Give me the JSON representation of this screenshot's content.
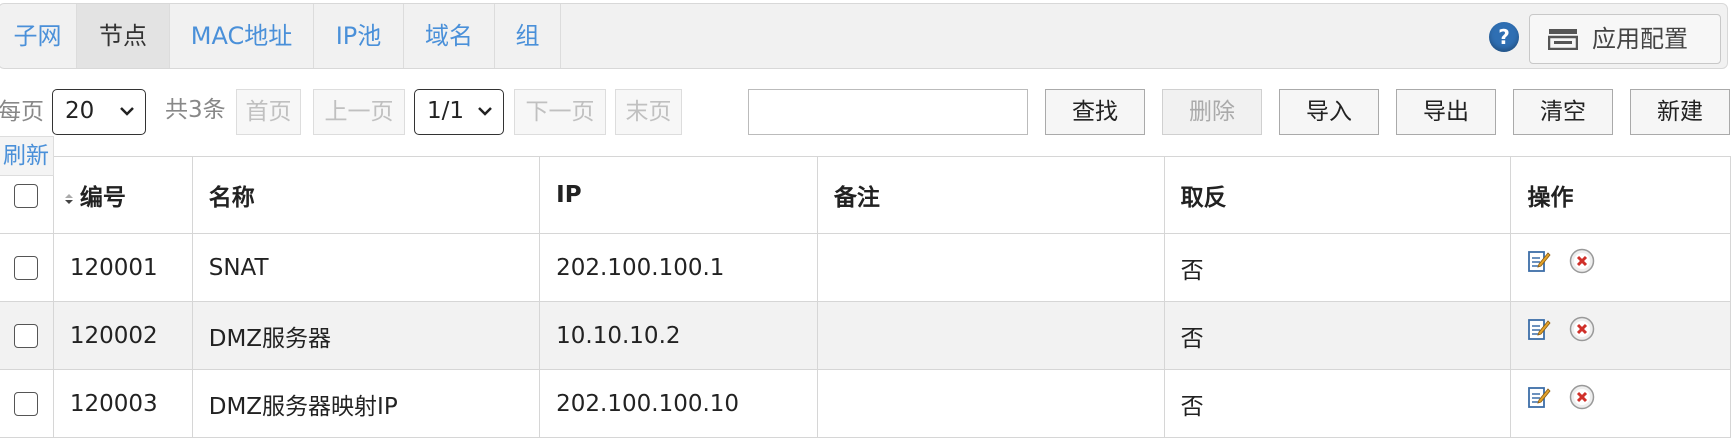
{
  "tabs": [
    {
      "label": "子网",
      "active": false
    },
    {
      "label": "节点",
      "active": true
    },
    {
      "label": "MAC地址",
      "active": false
    },
    {
      "label": "IP池",
      "active": false
    },
    {
      "label": "域名",
      "active": false
    },
    {
      "label": "组",
      "active": false
    }
  ],
  "header": {
    "help_icon": "question-mark",
    "help_glyph": "?",
    "apply_label": "应用配置",
    "apply_icon": "config-icon"
  },
  "pager": {
    "per_page_label": "每页",
    "per_page_value": "20",
    "total_label": "共3条",
    "first_label": "首页",
    "prev_label": "上一页",
    "page_value": "1/1",
    "next_label": "下一页",
    "last_label": "末页"
  },
  "search": {
    "value": "",
    "placeholder": ""
  },
  "actions": {
    "find": "查找",
    "delete": "删除",
    "import": "导入",
    "export": "导出",
    "clear": "清空",
    "new": "新建"
  },
  "refresh_label": "刷新",
  "table": {
    "columns": [
      "编号",
      "名称",
      "IP",
      "备注",
      "取反",
      "操作"
    ],
    "rows": [
      {
        "id": "120001",
        "name": "SNAT",
        "ip": "202.100.100.1",
        "note": "",
        "invert": "否"
      },
      {
        "id": "120002",
        "name": "DMZ服务器",
        "ip": "10.10.10.2",
        "note": "",
        "invert": "否"
      },
      {
        "id": "120003",
        "name": "DMZ服务器映射IP",
        "ip": "202.100.100.10",
        "note": "",
        "invert": "否"
      }
    ]
  },
  "colors": {
    "link_blue": "#4a90d9",
    "help_blue": "#2f6fb3",
    "delete_red": "#d0302a"
  }
}
